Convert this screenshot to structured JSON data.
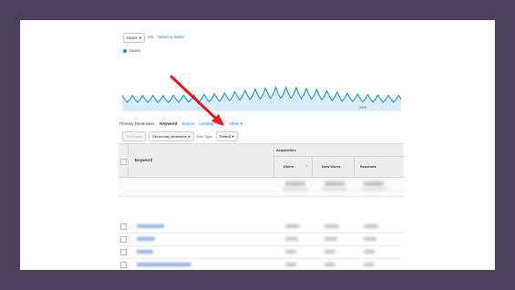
{
  "metric": {
    "selected": "Users",
    "vs": "VS.",
    "select_link": "Select a metric"
  },
  "legend": {
    "label": "Users",
    "color": "#058dc7"
  },
  "chart_axis": {
    "year_label": "2015",
    "corner_label": "· · ·"
  },
  "dimension": {
    "label": "Primary Dimension:",
    "active": "Keyword",
    "links": [
      "Source",
      "Landing Page",
      "Other"
    ]
  },
  "toolbar": {
    "plot_rows": "Plot Rows",
    "secondary": "Secondary dimension",
    "sort_label": "Sort Type:",
    "sort_value": "Default"
  },
  "table": {
    "keyword_header": "Keyword",
    "group_header": "Acquisition",
    "columns": [
      "Users",
      "New Users",
      "Sessions"
    ]
  },
  "colors": {
    "accent": "#1a73e8",
    "arrow": "#e01b1b",
    "background": "#4a3f5c"
  }
}
